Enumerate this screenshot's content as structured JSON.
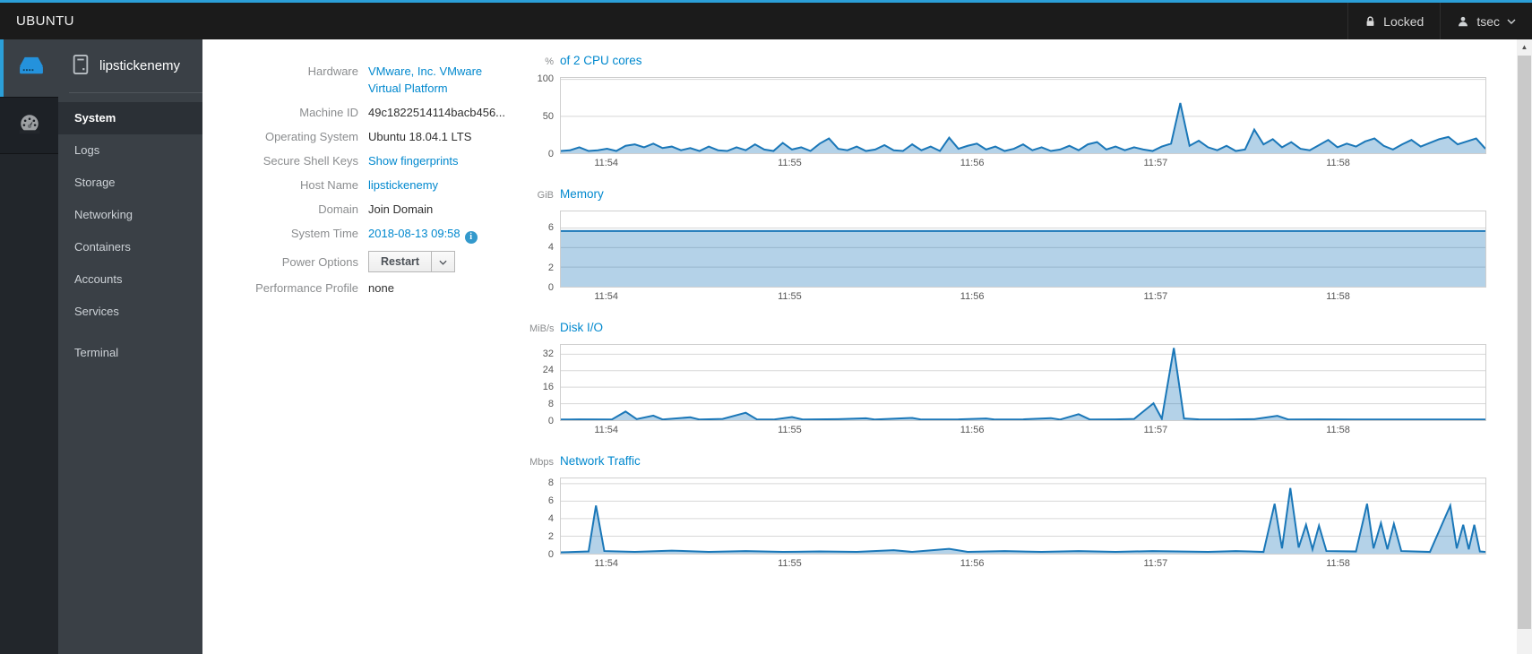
{
  "colors": {
    "accent_blue": "#2b9fd8",
    "link_blue": "#0088ce",
    "chart_line": "#1a77b8",
    "chart_fill": "rgba(26,119,184,0.33)",
    "navbar_bg": "#1b1b1b",
    "sidebar_bg": "#3a4046"
  },
  "icons": {
    "lock-icon": "padlock",
    "user-icon": "person silhouette",
    "chevron-down-icon": "v chevron",
    "server-icon": "blue server appliance",
    "dashboard-icon": "speedometer gauge",
    "host-icon": "computer tower outline",
    "info-icon": "i in blue circle",
    "scroll-up-icon": "▲"
  },
  "navbar": {
    "brand": "UBUNTU",
    "locked_label": "Locked",
    "user_label": "tsec"
  },
  "sidebar": {
    "host": "lipstickenemy",
    "items": [
      {
        "label": "System",
        "active": true
      },
      {
        "label": "Logs"
      },
      {
        "label": "Storage"
      },
      {
        "label": "Networking"
      },
      {
        "label": "Containers"
      },
      {
        "label": "Accounts"
      },
      {
        "label": "Services"
      },
      {
        "label": "Terminal"
      }
    ]
  },
  "info": {
    "rows": [
      {
        "label": "Hardware",
        "value": "VMware, Inc. VMware Virtual Platform"
      },
      {
        "label": "Machine ID",
        "value": "49c1822514114bacb456..."
      },
      {
        "label": "Operating System",
        "value": "Ubuntu 18.04.1 LTS"
      },
      {
        "label": "Secure Shell Keys",
        "value": "Show fingerprints"
      },
      {
        "label": "Host Name",
        "value": "lipstickenemy"
      },
      {
        "label": "Domain",
        "value": "Join Domain"
      },
      {
        "label": "System Time",
        "value": "2018-08-13 09:58",
        "icon": "i"
      },
      {
        "label": "Power Options",
        "value": "Restart"
      },
      {
        "label": "Performance Profile",
        "value": "none"
      }
    ]
  },
  "chart_data": [
    {
      "id": "0",
      "type": "area",
      "title": "of 2 CPU cores",
      "unit": "%",
      "grid": true,
      "legend": false,
      "ylim": [
        0,
        102
      ],
      "yticks": [
        100,
        50,
        0
      ],
      "xticks": [
        "11:54",
        "11:55",
        "11:56",
        "11:57",
        "11:58"
      ],
      "xtick_fracs": [
        0.05,
        0.248,
        0.445,
        0.643,
        0.84
      ],
      "values": [
        3,
        4,
        8,
        3,
        4,
        6,
        3,
        10,
        12,
        8,
        13,
        7,
        9,
        4,
        7,
        3,
        9,
        4,
        3,
        8,
        4,
        12,
        5,
        3,
        14,
        5,
        8,
        3,
        13,
        20,
        6,
        4,
        9,
        3,
        5,
        11,
        4,
        3,
        12,
        4,
        9,
        3,
        21,
        6,
        10,
        13,
        5,
        9,
        3,
        6,
        12,
        4,
        8,
        3,
        5,
        10,
        4,
        12,
        15,
        5,
        9,
        4,
        8,
        5,
        3,
        9,
        13,
        68,
        10,
        17,
        8,
        4,
        10,
        3,
        5,
        32,
        12,
        19,
        8,
        15,
        6,
        4,
        11,
        18,
        8,
        13,
        9,
        16,
        20,
        10,
        5,
        12,
        18,
        9,
        14,
        19,
        22,
        12,
        16,
        20,
        6
      ]
    },
    {
      "id": "1",
      "type": "area",
      "title": "Memory",
      "unit": "GiB",
      "grid": true,
      "legend": false,
      "ylim": [
        0,
        7.7
      ],
      "yticks": [
        6,
        4,
        2,
        0
      ],
      "xticks": [
        "11:54",
        "11:55",
        "11:56",
        "11:57",
        "11:58"
      ],
      "xtick_fracs": [
        0.05,
        0.248,
        0.445,
        0.643,
        0.84
      ],
      "values": [
        5.7,
        5.7
      ]
    },
    {
      "id": "2",
      "type": "area",
      "title": "Disk I/O",
      "unit": "MiB/s",
      "grid": true,
      "legend": false,
      "ylim": [
        0,
        36.5
      ],
      "yticks": [
        32,
        24,
        16,
        8,
        0
      ],
      "xticks": [
        "11:54",
        "11:55",
        "11:56",
        "11:57",
        "11:58"
      ],
      "xtick_fracs": [
        0.05,
        0.248,
        0.445,
        0.643,
        0.84
      ],
      "points": [
        [
          0,
          0.3
        ],
        [
          0.02,
          0.4
        ],
        [
          0.055,
          0.3
        ],
        [
          0.07,
          4.2
        ],
        [
          0.082,
          0.5
        ],
        [
          0.1,
          2.2
        ],
        [
          0.11,
          0.35
        ],
        [
          0.14,
          1.4
        ],
        [
          0.15,
          0.3
        ],
        [
          0.175,
          0.6
        ],
        [
          0.2,
          3.6
        ],
        [
          0.212,
          0.4
        ],
        [
          0.23,
          0.3
        ],
        [
          0.25,
          1.5
        ],
        [
          0.262,
          0.3
        ],
        [
          0.3,
          0.5
        ],
        [
          0.33,
          0.9
        ],
        [
          0.34,
          0.3
        ],
        [
          0.38,
          1.1
        ],
        [
          0.39,
          0.3
        ],
        [
          0.43,
          0.4
        ],
        [
          0.46,
          0.8
        ],
        [
          0.47,
          0.3
        ],
        [
          0.5,
          0.4
        ],
        [
          0.53,
          1.0
        ],
        [
          0.54,
          0.3
        ],
        [
          0.56,
          2.9
        ],
        [
          0.572,
          0.35
        ],
        [
          0.6,
          0.4
        ],
        [
          0.62,
          0.6
        ],
        [
          0.641,
          8.2
        ],
        [
          0.65,
          0.7
        ],
        [
          0.663,
          35
        ],
        [
          0.674,
          0.8
        ],
        [
          0.69,
          0.4
        ],
        [
          0.72,
          0.3
        ],
        [
          0.75,
          0.5
        ],
        [
          0.775,
          2.1
        ],
        [
          0.787,
          0.3
        ],
        [
          0.82,
          0.4
        ],
        [
          0.86,
          0.3
        ],
        [
          0.9,
          0.35
        ],
        [
          0.95,
          0.3
        ],
        [
          1,
          0.3
        ]
      ]
    },
    {
      "id": "3",
      "type": "area",
      "title": "Network Traffic",
      "unit": "Mbps",
      "grid": true,
      "legend": false,
      "ylim": [
        0,
        8.6
      ],
      "yticks": [
        8,
        6,
        4,
        2,
        0
      ],
      "xticks": [
        "11:54",
        "11:55",
        "11:56",
        "11:57",
        "11:58"
      ],
      "xtick_fracs": [
        0.05,
        0.248,
        0.445,
        0.643,
        0.84
      ],
      "points": [
        [
          0,
          0.15
        ],
        [
          0.03,
          0.25
        ],
        [
          0.038,
          5.5
        ],
        [
          0.047,
          0.3
        ],
        [
          0.08,
          0.2
        ],
        [
          0.12,
          0.35
        ],
        [
          0.16,
          0.2
        ],
        [
          0.2,
          0.3
        ],
        [
          0.24,
          0.2
        ],
        [
          0.28,
          0.25
        ],
        [
          0.32,
          0.2
        ],
        [
          0.36,
          0.4
        ],
        [
          0.38,
          0.2
        ],
        [
          0.42,
          0.55
        ],
        [
          0.44,
          0.2
        ],
        [
          0.48,
          0.3
        ],
        [
          0.52,
          0.2
        ],
        [
          0.56,
          0.3
        ],
        [
          0.6,
          0.2
        ],
        [
          0.64,
          0.3
        ],
        [
          0.7,
          0.2
        ],
        [
          0.73,
          0.3
        ],
        [
          0.76,
          0.2
        ],
        [
          0.772,
          5.7
        ],
        [
          0.78,
          0.6
        ],
        [
          0.789,
          7.5
        ],
        [
          0.798,
          0.7
        ],
        [
          0.806,
          3.3
        ],
        [
          0.813,
          0.5
        ],
        [
          0.82,
          3.2
        ],
        [
          0.828,
          0.3
        ],
        [
          0.86,
          0.25
        ],
        [
          0.872,
          5.7
        ],
        [
          0.879,
          0.6
        ],
        [
          0.887,
          3.5
        ],
        [
          0.894,
          0.5
        ],
        [
          0.901,
          3.4
        ],
        [
          0.909,
          0.3
        ],
        [
          0.94,
          0.2
        ],
        [
          0.962,
          5.5
        ],
        [
          0.969,
          0.6
        ],
        [
          0.976,
          3.3
        ],
        [
          0.982,
          0.5
        ],
        [
          0.988,
          3.3
        ],
        [
          0.994,
          0.25
        ],
        [
          1,
          0.2
        ]
      ]
    }
  ]
}
